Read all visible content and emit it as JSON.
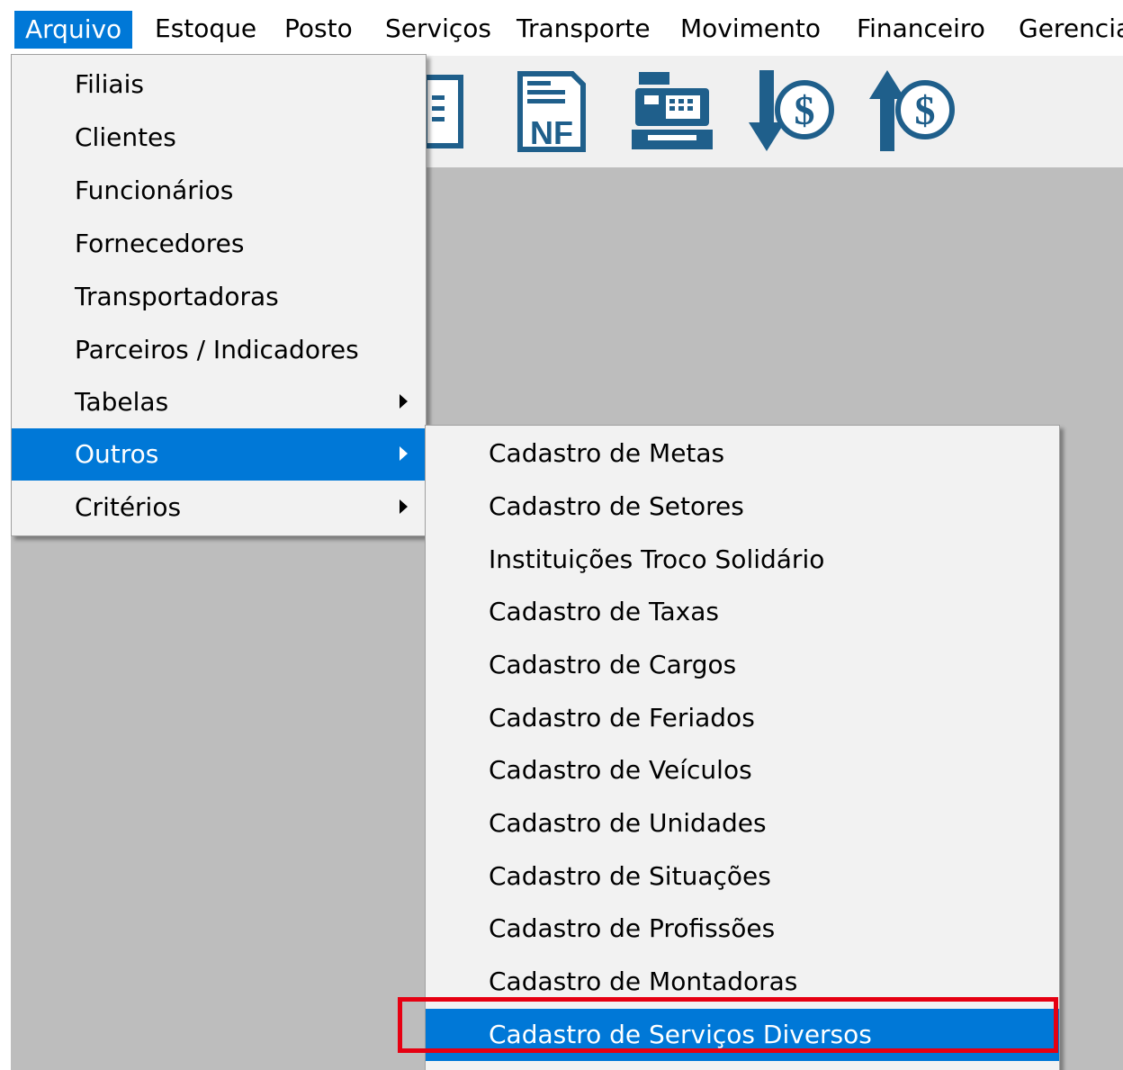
{
  "menubar": {
    "items": [
      "Arquivo",
      "Estoque",
      "Posto",
      "Serviços",
      "Transporte",
      "Movimento",
      "Financeiro",
      "Gerencia"
    ],
    "active": "Arquivo"
  },
  "toolbar": {
    "icons": [
      "document-icon",
      "nf-invoice-icon",
      "cash-register-icon",
      "money-down-icon",
      "money-up-icon"
    ],
    "nf_label": "NF",
    "dollar_label": "$",
    "accent_color": "#1f5f8b"
  },
  "menu_arquivo": {
    "items": [
      {
        "label": "Filiais",
        "submenu": false
      },
      {
        "label": "Clientes",
        "submenu": false
      },
      {
        "label": "Funcionários",
        "submenu": false
      },
      {
        "label": "Fornecedores",
        "submenu": false
      },
      {
        "label": "Transportadoras",
        "submenu": false
      },
      {
        "label": "Parceiros / Indicadores",
        "submenu": false
      },
      {
        "label": "Tabelas",
        "submenu": true
      },
      {
        "label": "Outros",
        "submenu": true,
        "highlighted": true
      },
      {
        "label": "Critérios",
        "submenu": true
      }
    ]
  },
  "menu_outros": {
    "items": [
      {
        "label": "Cadastro de Metas"
      },
      {
        "label": "Cadastro de Setores"
      },
      {
        "label": "Instituições Troco Solidário"
      },
      {
        "label": "Cadastro de Taxas"
      },
      {
        "label": "Cadastro de Cargos"
      },
      {
        "label": "Cadastro de Feriados"
      },
      {
        "label": "Cadastro de Veículos"
      },
      {
        "label": "Cadastro de Unidades"
      },
      {
        "label": "Cadastro de Situações"
      },
      {
        "label": "Cadastro de Profissões"
      },
      {
        "label": "Cadastro de Montadoras"
      },
      {
        "label": "Cadastro de Serviços Diversos",
        "highlighted": true
      }
    ]
  },
  "colors": {
    "highlight": "#0078d7",
    "annotation": "#e60012",
    "workspace": "#bdbdbd"
  }
}
